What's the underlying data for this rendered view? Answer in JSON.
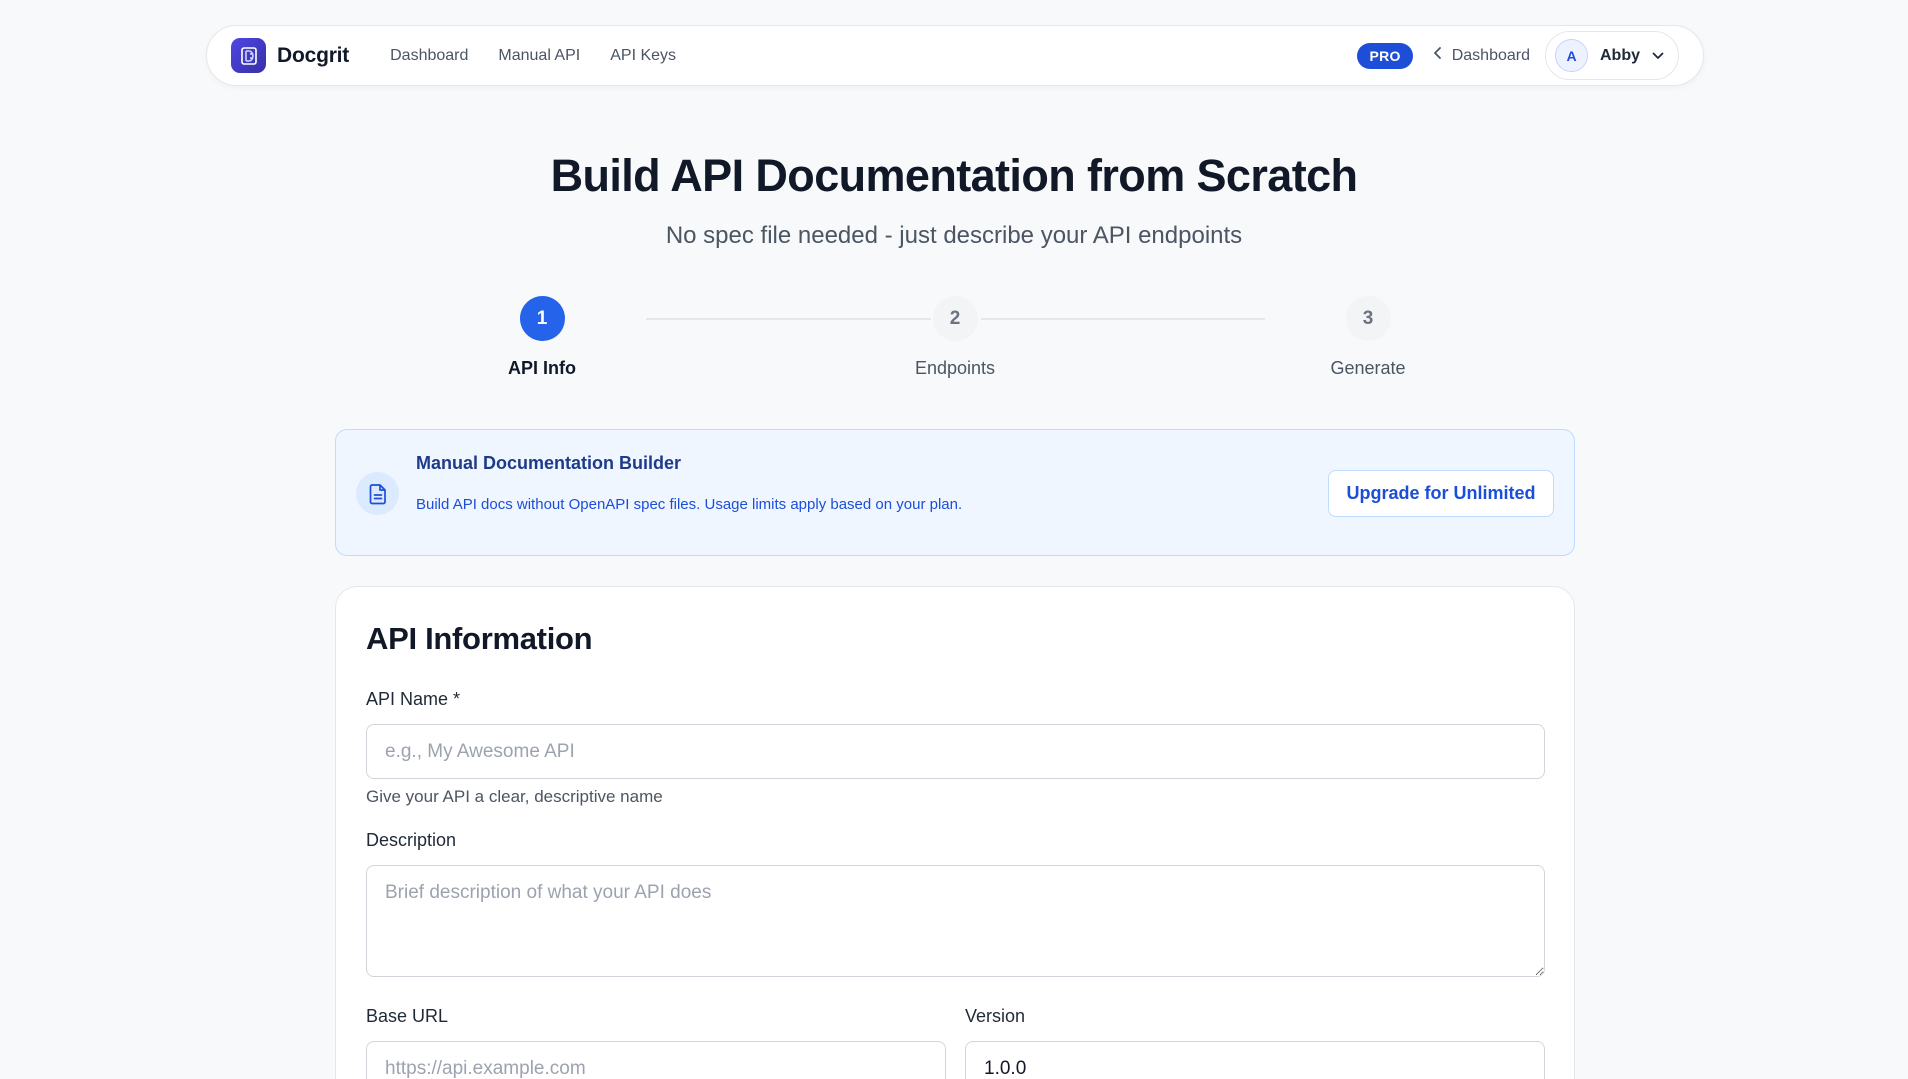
{
  "nav": {
    "brand": "Docgrit",
    "links": [
      "Dashboard",
      "Manual API",
      "API Keys"
    ],
    "pro_badge": "PRO",
    "back_link": "Dashboard",
    "user": {
      "initial": "A",
      "name": "Abby"
    }
  },
  "hero": {
    "title": "Build API Documentation from Scratch",
    "subtitle": "No spec file needed - just describe your API endpoints"
  },
  "stepper": {
    "current_step": 1,
    "steps": [
      {
        "number": "1",
        "label": "API Info"
      },
      {
        "number": "2",
        "label": "Endpoints"
      },
      {
        "number": "3",
        "label": "Generate"
      }
    ]
  },
  "banner": {
    "title": "Manual Documentation Builder",
    "description": "Build API docs without OpenAPI spec files. Usage limits apply based on your plan.",
    "button": "Upgrade for Unlimited"
  },
  "form": {
    "title": "API Information",
    "api_name": {
      "label": "API Name *",
      "placeholder": "e.g., My Awesome API",
      "value": "",
      "help": "Give your API a clear, descriptive name"
    },
    "description": {
      "label": "Description",
      "placeholder": "Brief description of what your API does",
      "value": ""
    },
    "base_url": {
      "label": "Base URL",
      "placeholder": "https://api.example.com",
      "value": ""
    },
    "version": {
      "label": "Version",
      "placeholder": "",
      "value": "1.0.0"
    }
  },
  "colors": {
    "accent": "#2563eb",
    "pro_badge": "#1d4ed8",
    "banner_bg": "#eff6ff",
    "banner_border": "#bfdbfe",
    "page_bg": "#f8f9fb"
  },
  "icons": {
    "logo": "docgrit-logo-icon",
    "back": "chevron-left-icon",
    "user_menu": "chevron-down-icon",
    "banner": "document-icon"
  }
}
